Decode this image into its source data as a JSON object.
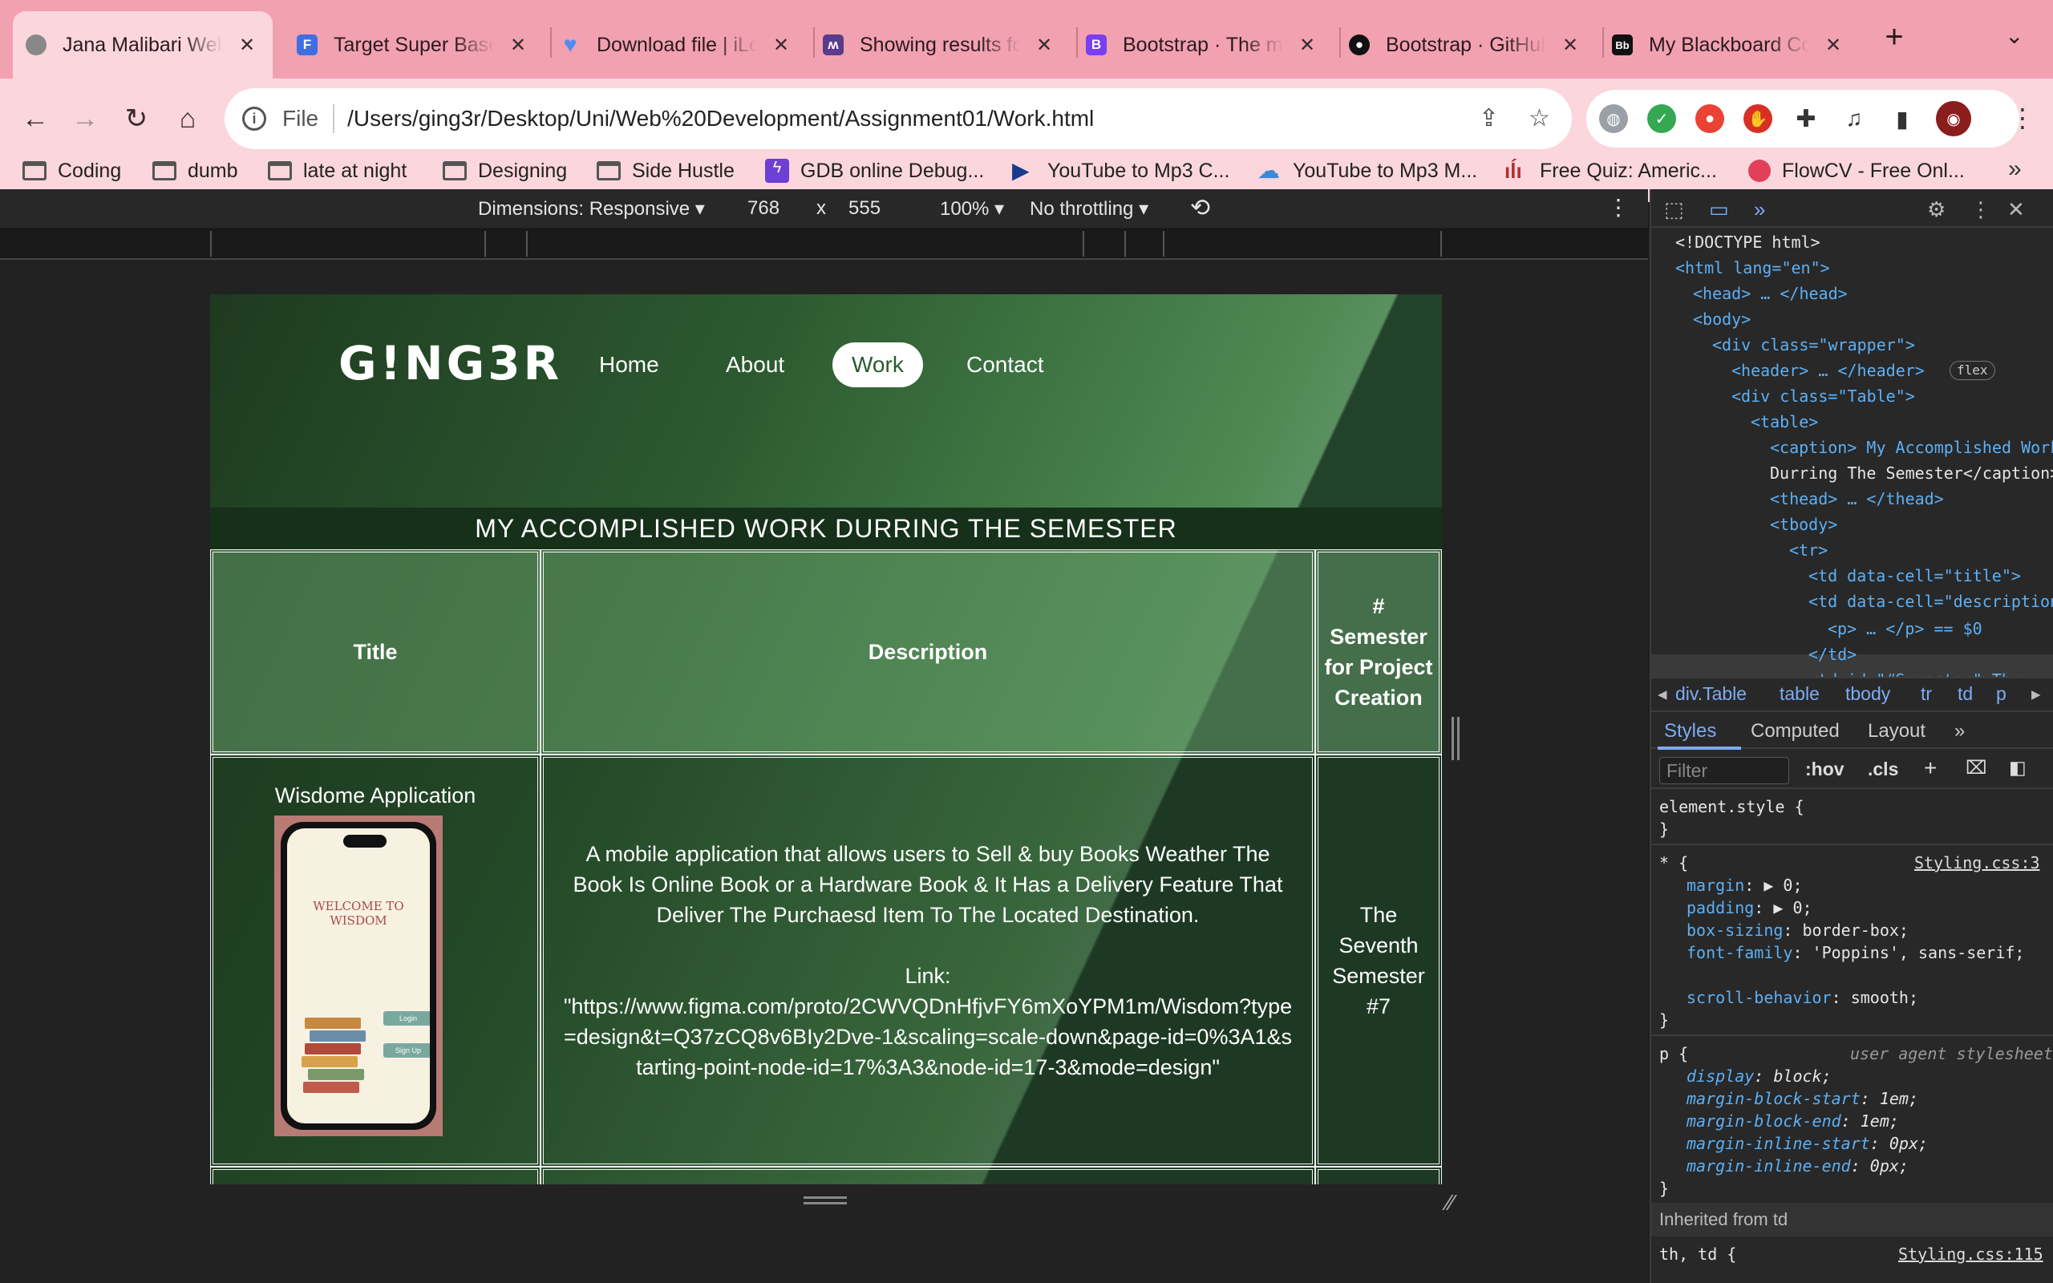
{
  "browser": {
    "tabs": [
      {
        "title": "Jana Malibari Web Development",
        "icon": "globe-icon",
        "color": "#888888",
        "active": true
      },
      {
        "title": "Target Super Base",
        "icon": "form-icon",
        "color": "#3f6fe0"
      },
      {
        "title": "Download file | iLovePDF",
        "icon": "heart-icon",
        "color": "#4f8cf0"
      },
      {
        "title": "Showing results for",
        "icon": "mascot-icon",
        "color": "#5a3b8c"
      },
      {
        "title": "Bootstrap · The most popular",
        "icon": "bootstrap-icon",
        "color": "#7a3ff0",
        "letter": "B"
      },
      {
        "title": "Bootstrap · GitHub",
        "icon": "github-icon",
        "color": "#111111"
      },
      {
        "title": "My Blackboard Courses",
        "icon": "blackboard-icon",
        "color": "#111111",
        "letter": "Bb"
      }
    ],
    "new_tab_label": "+",
    "omnibox": {
      "scheme": "File",
      "url": "/Users/ging3r/Desktop/Uni/Web%20Development/Assignment01/Work.html"
    },
    "bookmarks": [
      {
        "label": "Coding",
        "icon": "folder-icon"
      },
      {
        "label": "dumb",
        "icon": "folder-icon"
      },
      {
        "label": "late at night",
        "icon": "folder-icon"
      },
      {
        "label": "Designing",
        "icon": "folder-icon"
      },
      {
        "label": "Side Hustle",
        "icon": "folder-icon"
      },
      {
        "label": "GDB online Debug...",
        "icon": "gdb-icon",
        "color": "#6d3fd4"
      },
      {
        "label": "YouTube to Mp3 C...",
        "icon": "play-icon",
        "color": "#1a3a8a"
      },
      {
        "label": "YouTube to Mp3 M...",
        "icon": "cloud-download-icon",
        "color": "#3a8ad4"
      },
      {
        "label": "Free Quiz: Americ...",
        "icon": "quiz-icon",
        "color": "#b03030"
      },
      {
        "label": "FlowCV - Free Onl...",
        "icon": "flowcv-icon",
        "color": "#e0405a"
      }
    ],
    "bookmarks_more": "»"
  },
  "device_toolbar": {
    "dimensions_label": "Dimensions: Responsive",
    "width": "768",
    "times": "x",
    "height": "555",
    "zoom": "100%",
    "throttling": "No throttling"
  },
  "site": {
    "logo": "G!NG3R",
    "nav": [
      "Home",
      "About",
      "Work",
      "Contact"
    ],
    "active_nav": "Work",
    "caption": "MY ACCOMPLISHED WORK DURRING THE SEMESTER",
    "table_headers": [
      "Title",
      "Description",
      "# Semester for Project Creation"
    ],
    "row1": {
      "title": "Wisdome Application",
      "description": "A mobile application that allows users to Sell & buy Books Weather The Book Is Online Book or a Hardware Book & It Has a Delivery Feature That Deliver The Purchaesd Item To The Located Destination.",
      "link_label": "Link:",
      "link": "\"https://www.figma.com/proto/2CWVQDnHfjvFY6mXoYPM1m/Wisdom?type=design&t=Q37zCQ8v6BIy2Dve-1&scaling=scale-down&page-id=0%3A1&starting-point-node-id=17%3A3&node-id=17-3&mode=design\"",
      "semester": "The Seventh Semester #7"
    },
    "phone_mock": {
      "welcome": "WELCOME TO WISDOM",
      "login": "Login",
      "signup": "Sign Up"
    }
  },
  "devtools": {
    "dom": [
      {
        "text": "<!DOCTYPE html>"
      },
      {
        "text": "<html lang=\"en\">"
      },
      {
        "text": "<head> … </head>"
      },
      {
        "text": "<body>"
      },
      {
        "text": "<div class=\"wrapper\">"
      },
      {
        "text": "<header> … </header>",
        "badge": "flex"
      },
      {
        "text": "<div class=\"Table\">"
      },
      {
        "text": "<table>"
      },
      {
        "text": "<caption> My Accomplished Work"
      },
      {
        "text": "Durring The Semester</caption>"
      },
      {
        "text": "<thead> … </thead>"
      },
      {
        "text": "<tbody>"
      },
      {
        "text": "<tr>"
      },
      {
        "text": "<td data-cell=\"title\">"
      },
      {
        "text": "<td data-cell=\"description\">"
      },
      {
        "text": "<p> … </p> == $0"
      },
      {
        "text": "</td>"
      },
      {
        "text": "<td id=\"#Semester\">The"
      }
    ],
    "breadcrumbs": [
      "div.Table",
      "table",
      "tbody",
      "tr",
      "td",
      "p"
    ],
    "style_tabs": [
      "Styles",
      "Computed",
      "Layout"
    ],
    "filter_placeholder": "Filter",
    "filter_buttons": [
      ":hov",
      ".cls"
    ],
    "styles": {
      "element_style": "element.style {",
      "universal_selector": "* {",
      "universal_source": "Styling.css:3",
      "universal_props": [
        {
          "p": "margin",
          "v": "▶ 0;"
        },
        {
          "p": "padding",
          "v": "▶ 0;"
        },
        {
          "p": "box-sizing",
          "v": "border-box;"
        },
        {
          "p": "font-family",
          "v": "'Poppins', sans-serif;"
        },
        {
          "p": "scroll-behavior",
          "v": "smooth;"
        }
      ],
      "p_selector": "p {",
      "p_source": "user agent stylesheet",
      "p_props": [
        {
          "p": "display",
          "v": "block;"
        },
        {
          "p": "margin-block-start",
          "v": "1em;"
        },
        {
          "p": "margin-block-end",
          "v": "1em;"
        },
        {
          "p": "margin-inline-start",
          "v": "0px;"
        },
        {
          "p": "margin-inline-end",
          "v": "0px;"
        }
      ],
      "inherited": "Inherited from td",
      "last_selector": "th, td {",
      "last_source": "Styling.css:115"
    }
  }
}
